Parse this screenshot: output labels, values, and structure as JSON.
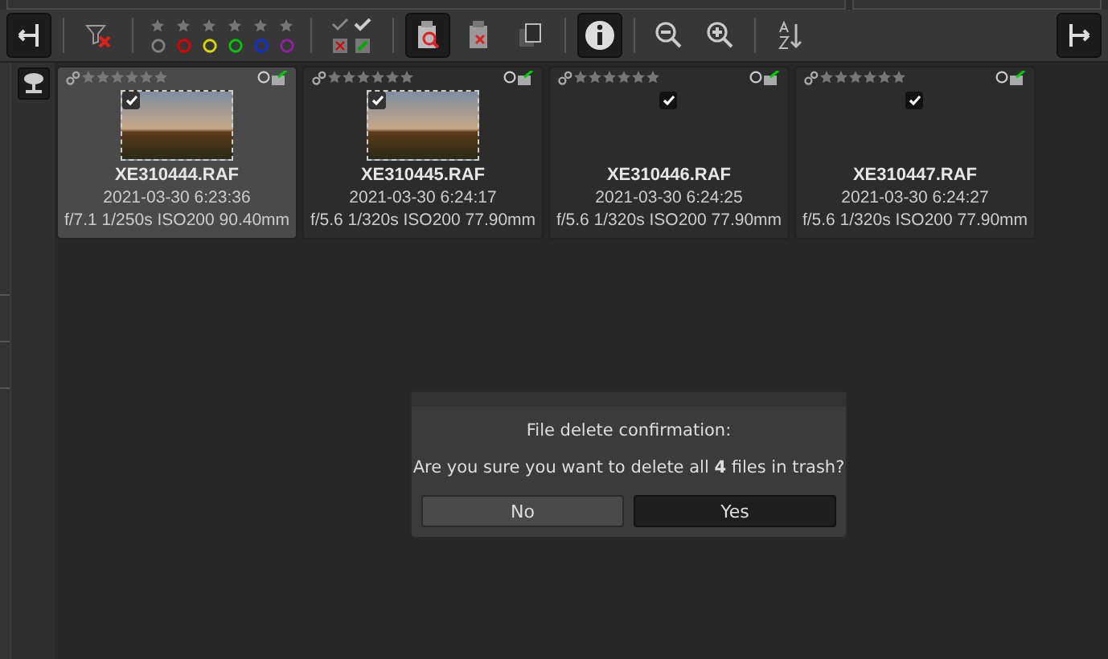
{
  "toolbar": {
    "left_items": [
      {
        "kind": "panel-left",
        "pressed": true
      },
      {
        "kind": "trash-filter",
        "pressed": false
      }
    ],
    "color_filters": [
      {
        "color": "#808080"
      },
      {
        "color": "#e00000"
      },
      {
        "color": "#d8d800"
      },
      {
        "color": "#00c800"
      },
      {
        "color": "#1030e0"
      },
      {
        "color": "#9020a0"
      }
    ],
    "items": [
      {
        "kind": "check-edited",
        "pressed": false
      },
      {
        "kind": "trash-search",
        "pressed": true
      },
      {
        "kind": "trash-delete",
        "pressed": false
      },
      {
        "kind": "copy",
        "pressed": false
      },
      {
        "kind": "info",
        "pressed": true
      },
      {
        "kind": "zoom-out",
        "pressed": false
      },
      {
        "kind": "zoom-in",
        "pressed": false
      },
      {
        "kind": "sort",
        "pressed": false
      }
    ],
    "right_items": [
      {
        "kind": "panel-right",
        "pressed": true
      }
    ]
  },
  "thumbnails": [
    {
      "filename": "XE310444.RAF",
      "date": "2021-03-30 6:23:36",
      "exif": "f/7.1 1/250s ISO200 90.40mm",
      "stars": 0,
      "selected": true,
      "checked": true,
      "has_preview": true
    },
    {
      "filename": "XE310445.RAF",
      "date": "2021-03-30 6:24:17",
      "exif": "f/5.6 1/320s ISO200 77.90mm",
      "stars": 0,
      "selected": false,
      "checked": true,
      "has_preview": true
    },
    {
      "filename": "XE310446.RAF",
      "date": "2021-03-30 6:24:25",
      "exif": "f/5.6 1/320s ISO200 77.90mm",
      "stars": 0,
      "selected": false,
      "checked": true,
      "has_preview": false
    },
    {
      "filename": "XE310447.RAF",
      "date": "2021-03-30 6:24:27",
      "exif": "f/5.6 1/320s ISO200 77.90mm",
      "stars": 0,
      "selected": false,
      "checked": true,
      "has_preview": false
    }
  ],
  "dialog": {
    "title": "File delete confirmation:",
    "message": "Are you sure you want to delete all **4** files in trash?",
    "buttons": [
      {
        "label": "No",
        "selected": false
      },
      {
        "label": "Yes",
        "selected": true
      }
    ]
  }
}
